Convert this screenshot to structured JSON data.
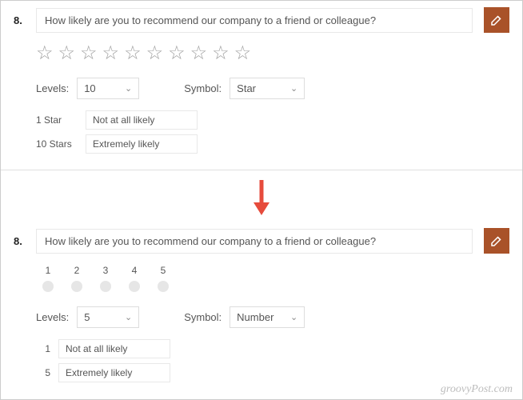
{
  "top": {
    "number": "8.",
    "question": "How likely are you to recommend our company to a friend or colleague?",
    "stars_count": 10,
    "levels_label": "Levels:",
    "levels_value": "10",
    "symbol_label": "Symbol:",
    "symbol_value": "Star",
    "legend_low_key": "1 Star",
    "legend_low_val": "Not at all likely",
    "legend_high_key": "10 Stars",
    "legend_high_val": "Extremely likely"
  },
  "bottom": {
    "number": "8.",
    "question": "How likely are you to recommend our company to a friend or colleague?",
    "numbers": [
      "1",
      "2",
      "3",
      "4",
      "5"
    ],
    "levels_label": "Levels:",
    "levels_value": "5",
    "symbol_label": "Symbol:",
    "symbol_value": "Number",
    "legend_low_key": "1",
    "legend_low_val": "Not at all likely",
    "legend_high_key": "5",
    "legend_high_val": "Extremely likely"
  },
  "watermark": "groovyPost.com"
}
